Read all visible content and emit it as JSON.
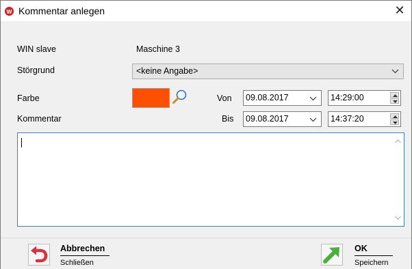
{
  "window": {
    "title": "Kommentar anlegen",
    "close_glyph": "✕"
  },
  "form": {
    "win_slave_label": "WIN slave",
    "win_slave_value": "Maschine 3",
    "stoergrund_label": "Störgrund",
    "stoergrund_value": "<keine Angabe>",
    "farbe_label": "Farbe",
    "farbe_color": "#ff4f00",
    "von_label": "Von",
    "von_date": "09.08.2017",
    "von_time": "14:29:00",
    "bis_label": "Bis",
    "bis_date": "09.08.2017",
    "bis_time": "14:37:20",
    "kommentar_label": "Kommentar",
    "kommentar_text": ""
  },
  "buttons": {
    "cancel_label": "Abbrechen",
    "cancel_sub": "Schließen",
    "ok_label": "OK",
    "ok_sub": "Speichern"
  },
  "icons": {
    "title": "company-logo-icon",
    "picker": "magnifier-icon",
    "cancel": "undo-arrow-icon",
    "ok": "confirm-arrow-icon"
  }
}
